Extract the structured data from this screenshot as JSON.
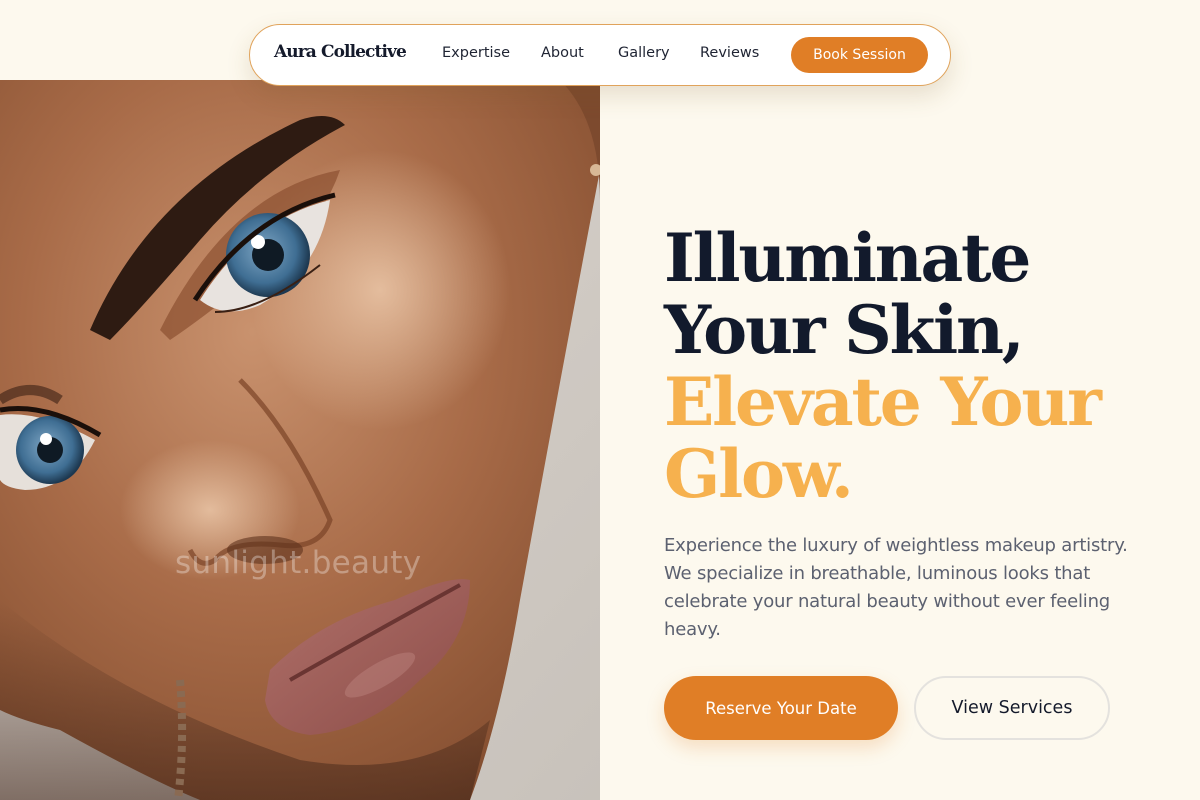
{
  "brand": {
    "name": "Aura Collective"
  },
  "nav": {
    "links": [
      "Expertise",
      "About",
      "Gallery",
      "Reviews"
    ],
    "cta_label": "Book Session"
  },
  "hero": {
    "headline_lines": [
      "Illuminate",
      "Your Skin,"
    ],
    "headline_accent_lines": [
      "Elevate Your",
      "Glow."
    ],
    "description": "Experience the luxury of weightless makeup artistry. We specialize in breathable, luminous looks that celebrate your natural beauty without ever feeling heavy.",
    "primary_cta": "Reserve Your Date",
    "secondary_cta": "View Services",
    "image_watermark": "sunlight.beauty"
  },
  "colors": {
    "background": "#fdf9ee",
    "accent_orange": "#e07e26",
    "headline_gold": "#f6b14e",
    "headline_dark": "#121a2c",
    "body_text": "#5c6170"
  }
}
